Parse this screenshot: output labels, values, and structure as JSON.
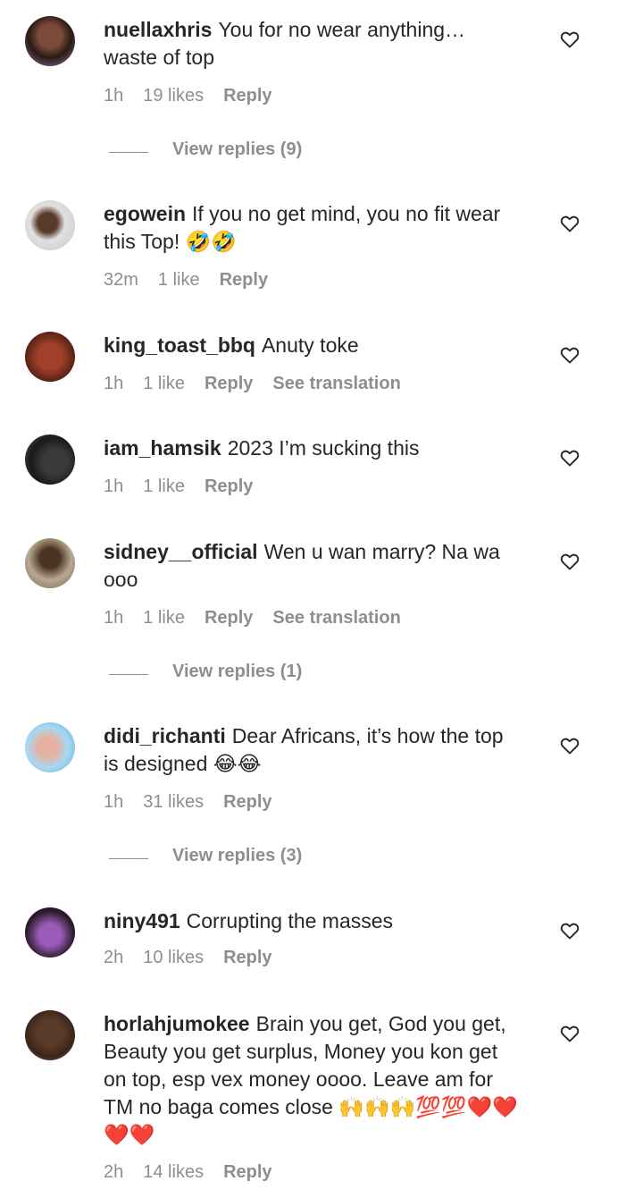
{
  "comments": [
    {
      "username": "nuellaxhris",
      "text": "You for no wear anything… waste of top",
      "time": "1h",
      "likes": "19 likes",
      "reply": "Reply",
      "view_replies": "View replies (9)"
    },
    {
      "username": "egowein",
      "text": "If you no get mind, you no fit wear this Top! 🤣🤣",
      "time": "32m",
      "likes": "1 like",
      "reply": "Reply"
    },
    {
      "username": "king_toast_bbq",
      "text": "Anuty toke",
      "time": "1h",
      "likes": "1 like",
      "reply": "Reply",
      "translate": "See translation"
    },
    {
      "username": "iam_hamsik",
      "text": "2023 I’m sucking this",
      "time": "1h",
      "likes": "1 like",
      "reply": "Reply"
    },
    {
      "username": "sidney__official",
      "text": "Wen u wan marry? Na wa ooo",
      "time": "1h",
      "likes": "1 like",
      "reply": "Reply",
      "translate": "See translation",
      "view_replies": "View replies (1)"
    },
    {
      "username": "didi_richanti",
      "text": "Dear Africans, it’s how the top is designed 😂😂",
      "time": "1h",
      "likes": "31 likes",
      "reply": "Reply",
      "view_replies": "View replies (3)"
    },
    {
      "username": "niny491",
      "text": "Corrupting the masses",
      "time": "2h",
      "likes": "10 likes",
      "reply": "Reply"
    },
    {
      "username": "horlahjumokee",
      "text": "Brain you get, God you get, Beauty you get surplus, Money you kon get on top, esp vex money oooo. Leave am for TM no baga comes close 🙌🙌🙌💯💯❤️❤️❤️❤️",
      "time": "2h",
      "likes": "14 likes",
      "reply": "Reply"
    }
  ],
  "icons": {
    "like": "heart-outline-icon"
  },
  "colors": {
    "text": "#262626",
    "secondary": "#8e8e8e",
    "background": "#ffffff"
  }
}
